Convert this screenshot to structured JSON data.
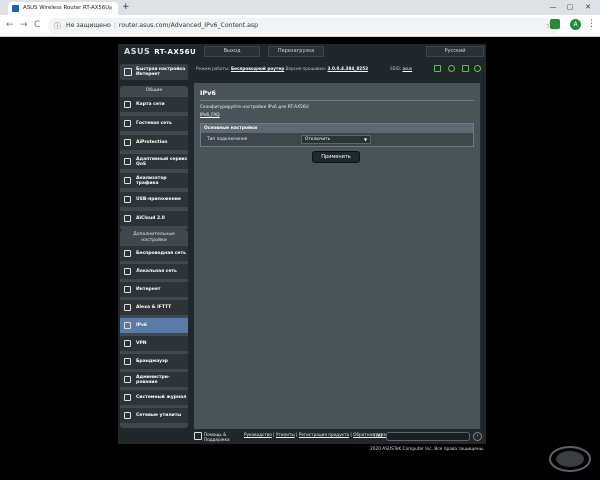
{
  "browser": {
    "tab_title": "ASUS Wireless Router RT-AX56U",
    "tab_close": "×",
    "new_tab": "+",
    "window_min": "—",
    "window_max": "▢",
    "window_close": "✕",
    "back": "←",
    "forward": "→",
    "reload": "C",
    "security_label": "Не защищено",
    "url": "router.asus.com/Advanced_IPv6_Content.asp",
    "star": "☆",
    "avatar_letter": "A",
    "menu": "⋮"
  },
  "router": {
    "logo": "ASUS",
    "model": "RT-AX56U",
    "logout": "Выход",
    "reboot": "Перезагрузка",
    "language": "Русский",
    "status": {
      "mode_label": "Режим работы:",
      "mode_value": "Беспроводной роутер",
      "fw_label": "Версия прошивки:",
      "fw_value": "3.0.0.4.384_8253",
      "ssid_label": "SSID:",
      "ssid_value": "asus"
    }
  },
  "sidebar": {
    "quick_setup": "Быстрая настройка Интернет",
    "general_header": "Общие",
    "general_items": [
      {
        "label": "Карта сети",
        "icon": "network-map-icon"
      },
      {
        "label": "Гостевая сеть",
        "icon": "guest-network-icon"
      },
      {
        "label": "AiProtection",
        "icon": "shield-icon"
      },
      {
        "label": "Адаптивный сервис QoS",
        "icon": "qos-icon"
      },
      {
        "label": "Анализатор трафика",
        "icon": "traffic-icon"
      },
      {
        "label": "USB-приложение",
        "icon": "usb-icon"
      },
      {
        "label": "AiCloud 2.0",
        "icon": "cloud-icon"
      }
    ],
    "advanced_header": "Дополнительные настройки",
    "advanced_items": [
      {
        "label": "Беспроводная сеть",
        "icon": "wifi-icon"
      },
      {
        "label": "Локальная сеть",
        "icon": "lan-icon"
      },
      {
        "label": "Интернет",
        "icon": "globe-icon"
      },
      {
        "label": "Alexa & IFTTT",
        "icon": "alexa-icon"
      },
      {
        "label": "IPv6",
        "icon": "ipv6-icon"
      },
      {
        "label": "VPN",
        "icon": "vpn-icon"
      },
      {
        "label": "Брандмауэр",
        "icon": "firewall-icon"
      },
      {
        "label": "Администри-рование",
        "icon": "admin-icon"
      },
      {
        "label": "Системный журнал",
        "icon": "log-icon"
      },
      {
        "label": "Сетевые утилиты",
        "icon": "tools-icon"
      }
    ],
    "selected": "IPv6"
  },
  "main": {
    "title": "IPv6",
    "description": "Сконфигурируйте настройки IPv6 для RT-AX56U",
    "faq_link": "IPv6_FAQ",
    "section_header": "Основные настройки",
    "connection_type_label": "Тип подключения",
    "connection_type_value": "Отключить",
    "apply": "Применить"
  },
  "footer": {
    "help": "Помощь & Поддержка",
    "links": [
      "Руководство",
      "Утилиты",
      "Регистрация продукта",
      "Обратная связь"
    ],
    "faq_label": "FAQ",
    "copyright": "2020 ASUSTeK Computer Inc. Все права защищены."
  },
  "colors": {
    "accent_selected": "#5a7aa8",
    "router_bg": "#21282b",
    "content_bg": "#4a5357"
  }
}
